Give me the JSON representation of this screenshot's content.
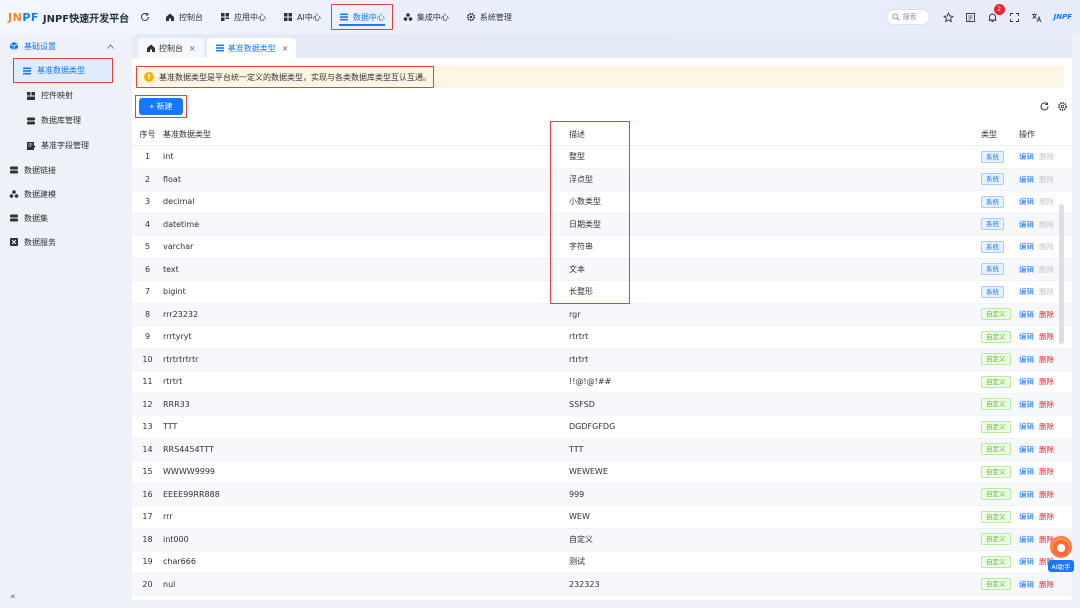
{
  "app": {
    "logo_part1": "JN",
    "logo_part2": "PF",
    "title": "JNPF快速开发平台",
    "brand_mark": "JNPF",
    "accent_color": "#1677ff",
    "highlight_color": "#e53e3e"
  },
  "nav": {
    "items": [
      {
        "label": "控制台",
        "icon": "home-icon"
      },
      {
        "label": "应用中心",
        "icon": "app-grid-icon"
      },
      {
        "label": "AI中心",
        "icon": "ai-grid-icon"
      },
      {
        "label": "数据中心",
        "icon": "list-icon",
        "active": true
      },
      {
        "label": "集成中心",
        "icon": "integration-icon"
      },
      {
        "label": "系统管理",
        "icon": "gear-icon"
      }
    ]
  },
  "header": {
    "search_placeholder": "搜索",
    "notification_count": "2"
  },
  "sidebar": {
    "group_basic": "基础设置",
    "sub_items": [
      {
        "label": "基准数据类型",
        "active": true
      },
      {
        "label": "控件映射"
      },
      {
        "label": "数据库管理"
      },
      {
        "label": "基准字段管理"
      }
    ],
    "groups": [
      {
        "label": "数据链接"
      },
      {
        "label": "数据建模"
      },
      {
        "label": "数据集"
      },
      {
        "label": "数据服务"
      }
    ],
    "collapse_glyph": "«"
  },
  "tabs": [
    {
      "label": "控制台"
    },
    {
      "label": "基准数据类型",
      "active": true
    }
  ],
  "alert": {
    "text": "基准数据类型是平台统一定义的数据类型，实现与各类数据库类型互认互通。"
  },
  "toolbar": {
    "new_label": "+ 新建"
  },
  "table": {
    "headers": {
      "no": "序号",
      "name": "基准数据类型",
      "desc": "描述",
      "type": "类型",
      "op": "操作"
    },
    "edit_label": "编辑",
    "delete_label": "删除",
    "rows": [
      {
        "no": "1",
        "name": "int",
        "desc": "整型",
        "type": "系统",
        "kind": "sys"
      },
      {
        "no": "2",
        "name": "float",
        "desc": "浮点型",
        "type": "系统",
        "kind": "sys"
      },
      {
        "no": "3",
        "name": "decimal",
        "desc": "小数类型",
        "type": "系统",
        "kind": "sys"
      },
      {
        "no": "4",
        "name": "datetime",
        "desc": "日期类型",
        "type": "系统",
        "kind": "sys"
      },
      {
        "no": "5",
        "name": "varchar",
        "desc": "字符串",
        "type": "系统",
        "kind": "sys"
      },
      {
        "no": "6",
        "name": "text",
        "desc": "文本",
        "type": "系统",
        "kind": "sys"
      },
      {
        "no": "7",
        "name": "bigint",
        "desc": "长整形",
        "type": "系统",
        "kind": "sys"
      },
      {
        "no": "8",
        "name": "rrr23232",
        "desc": "rgr",
        "type": "自定义",
        "kind": "cus"
      },
      {
        "no": "9",
        "name": "rrrtyryt",
        "desc": "rtrtrt",
        "type": "自定义",
        "kind": "cus"
      },
      {
        "no": "10",
        "name": "rtrtrtrtrtr",
        "desc": "rtrtrt",
        "type": "自定义",
        "kind": "cus"
      },
      {
        "no": "11",
        "name": "rtrtrt",
        "desc": "!!@!@!##",
        "type": "自定义",
        "kind": "cus"
      },
      {
        "no": "12",
        "name": "RRR33",
        "desc": "SSFSD",
        "type": "自定义",
        "kind": "cus"
      },
      {
        "no": "13",
        "name": "TTT",
        "desc": "DGDFGFDG",
        "type": "自定义",
        "kind": "cus"
      },
      {
        "no": "14",
        "name": "RRS4454TTT",
        "desc": "TTT",
        "type": "自定义",
        "kind": "cus"
      },
      {
        "no": "15",
        "name": "WWWW9999",
        "desc": "WEWEWE",
        "type": "自定义",
        "kind": "cus"
      },
      {
        "no": "16",
        "name": "EEEE99RR888",
        "desc": "999",
        "type": "自定义",
        "kind": "cus"
      },
      {
        "no": "17",
        "name": "rrr",
        "desc": "WEW",
        "type": "自定义",
        "kind": "cus"
      },
      {
        "no": "18",
        "name": "int000",
        "desc": "自定义",
        "type": "自定义",
        "kind": "cus"
      },
      {
        "no": "19",
        "name": "char666",
        "desc": "测试",
        "type": "自定义",
        "kind": "cus"
      },
      {
        "no": "20",
        "name": "nul",
        "desc": "232323",
        "type": "自定义",
        "kind": "cus"
      }
    ]
  },
  "ai_assistant": {
    "label": "AI助手"
  }
}
